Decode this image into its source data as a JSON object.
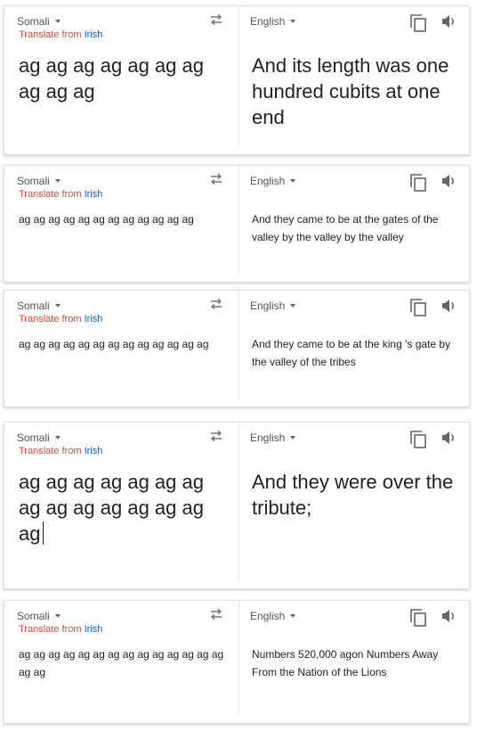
{
  "cards": [
    {
      "source_lang": "Somali",
      "target_lang": "English",
      "hint_prefix": "Translate from ",
      "hint_link": "Irish",
      "source_text": "ag ag ag ag ag ag ag ag ag ag",
      "target_text": "And its length was one hundred cubits at one end"
    },
    {
      "source_lang": "Somali",
      "target_lang": "English",
      "hint_prefix": "Translate from ",
      "hint_link": "Irish",
      "source_text": "ag ag ag ag ag ag ag ag ag ag ag ag",
      "target_text": "And they came to be at the gates of the valley by the valley by the valley"
    },
    {
      "source_lang": "Somali",
      "target_lang": "English",
      "hint_prefix": "Translate from ",
      "hint_link": "Irish",
      "source_text": "ag ag ag ag ag ag ag ag ag ag ag ag ag",
      "target_text": "And they came to be at the king 's gate by the valley of the tribes"
    },
    {
      "source_lang": "Somali",
      "target_lang": "English",
      "hint_prefix": "Translate from ",
      "hint_link": "Irish",
      "source_text": "ag ag ag ag ag ag ag ag ag ag ag ag ag ag ag",
      "target_text": "And they were over the tribute;"
    },
    {
      "source_lang": "Somali",
      "target_lang": "English",
      "hint_prefix": "Translate from ",
      "hint_link": "Irish",
      "source_text": "ag ag ag ag ag ag ag ag ag ag ag ag ag ag ag ag",
      "target_text": "Numbers 520,000 agon Numbers Away From the Nation of the Lions"
    }
  ]
}
